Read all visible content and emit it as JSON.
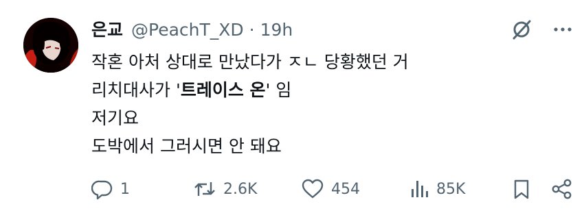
{
  "tweet": {
    "display_name": "은교",
    "handle": "@PeachT_XD",
    "separator": "·",
    "time": "19h",
    "lines": [
      "작혼 아처 상대로 만났다가 ㅈㄴ 당황했던 거",
      "저기요",
      "도박에서 그러시면 안 돼요"
    ],
    "line2": {
      "before": "리치대사가 '",
      "bold": "트레이스 온",
      "after": "' 임"
    }
  },
  "actions": {
    "reply_count": "1",
    "retweet_count": "2.6K",
    "like_count": "454",
    "views_count": "85K"
  },
  "icons": {
    "avatar": "avatar",
    "grok": "grok-icon",
    "more": "more-icon",
    "reply": "reply-icon",
    "retweet": "retweet-icon",
    "like": "heart-icon",
    "views": "views-icon",
    "bookmark": "bookmark-icon",
    "share": "share-icon"
  },
  "colors": {
    "text": "#0f1419",
    "secondary": "#536471",
    "background": "#ffffff"
  }
}
